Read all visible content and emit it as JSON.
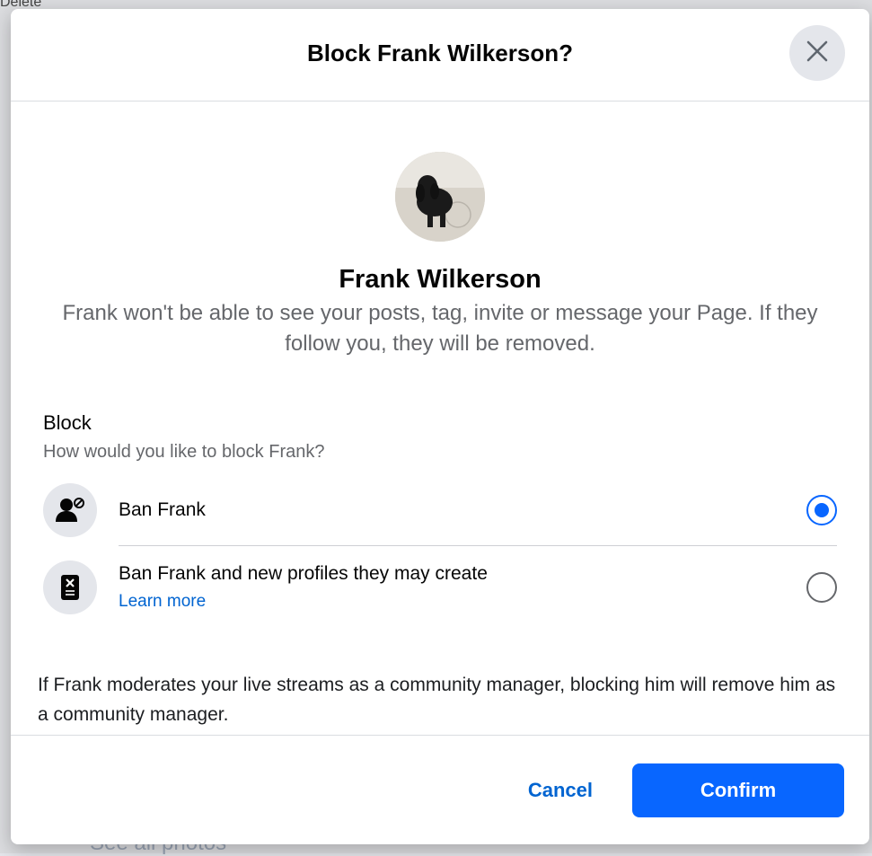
{
  "background": {
    "top_text": "Delete",
    "bottom_text": "See all photos"
  },
  "dialog": {
    "title": "Block Frank Wilkerson?",
    "close_icon": "close-icon",
    "profile": {
      "name": "Frank Wilkerson",
      "description": "Frank won't be able to see your posts, tag, invite or message your Page. If they follow you, they will be removed."
    },
    "block": {
      "heading": "Block",
      "subheading": "How would you like to block Frank?",
      "options": [
        {
          "label": "Ban Frank",
          "icon": "person-ban-icon",
          "selected": true
        },
        {
          "label": "Ban Frank and new profiles they may create",
          "link": "Learn more",
          "icon": "document-x-icon",
          "selected": false
        }
      ]
    },
    "note": "If Frank moderates your live streams as a community manager, blocking him will remove him as a community manager.",
    "footer": {
      "cancel_label": "Cancel",
      "confirm_label": "Confirm"
    }
  },
  "colors": {
    "accent": "#0866ff",
    "link": "#0064d1",
    "secondary_text": "#65676b"
  }
}
